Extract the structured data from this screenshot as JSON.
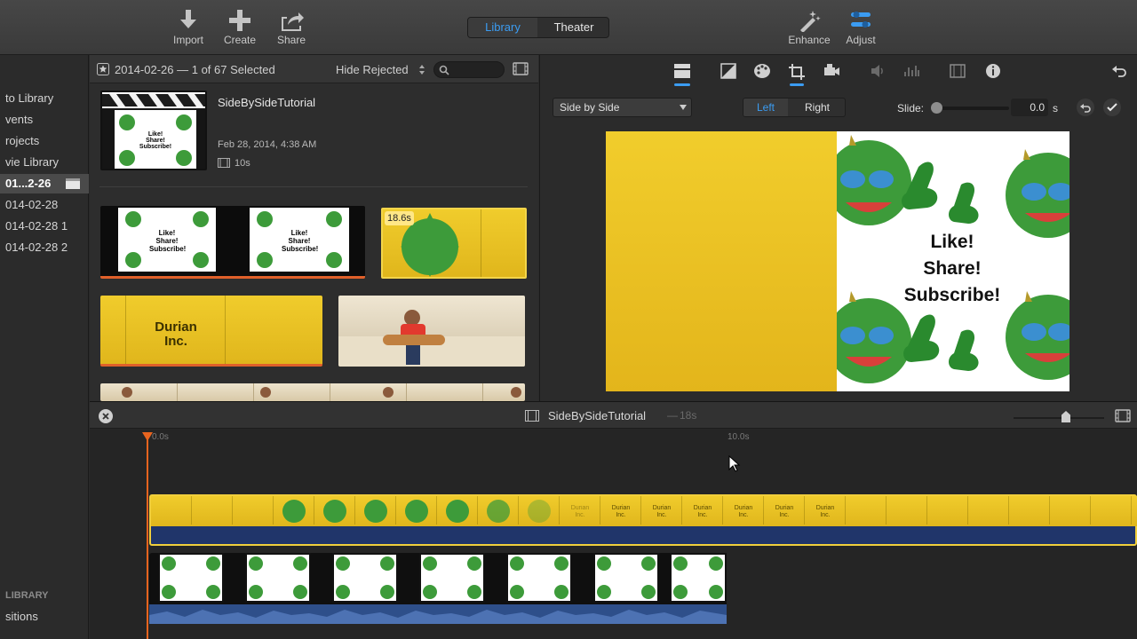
{
  "toolbar": {
    "import": "Import",
    "create": "Create",
    "share": "Share",
    "library": "Library",
    "theater": "Theater",
    "enhance": "Enhance",
    "adjust": "Adjust",
    "accent": "#3b9cf2"
  },
  "sidebar": {
    "items": [
      "to Library",
      "vents",
      "rojects",
      "vie Library",
      "01...2-26",
      "014-02-28",
      "014-02-28 1",
      "014-02-28 2"
    ],
    "section_header": "LIBRARY",
    "bottom_item": "sitions"
  },
  "browser": {
    "event_title": "2014-02-26 — 1 of 67 Selected",
    "hide_rejected": "Hide Rejected",
    "project_name": "SideBySideTutorial",
    "project_date": "Feb 28, 2014, 4:38 AM",
    "project_duration": "10s",
    "clip_duration": "18.6s",
    "title_card": "Durian\nInc.",
    "thumb_text": "Like!\nShare!\nSubscribe!"
  },
  "viewer": {
    "overlay_mode": "Side by Side",
    "left": "Left",
    "right": "Right",
    "slide_label": "Slide:",
    "slide_value": "0.0",
    "slide_unit": "s",
    "preview_text": "Like!\nShare!\nSubscribe!"
  },
  "timeline": {
    "project_name": "SideBySideTutorial",
    "duration": "18s",
    "tick_start": "0.0s",
    "tick_mid": "10.0s",
    "durian_label": "Durian\nInc."
  }
}
